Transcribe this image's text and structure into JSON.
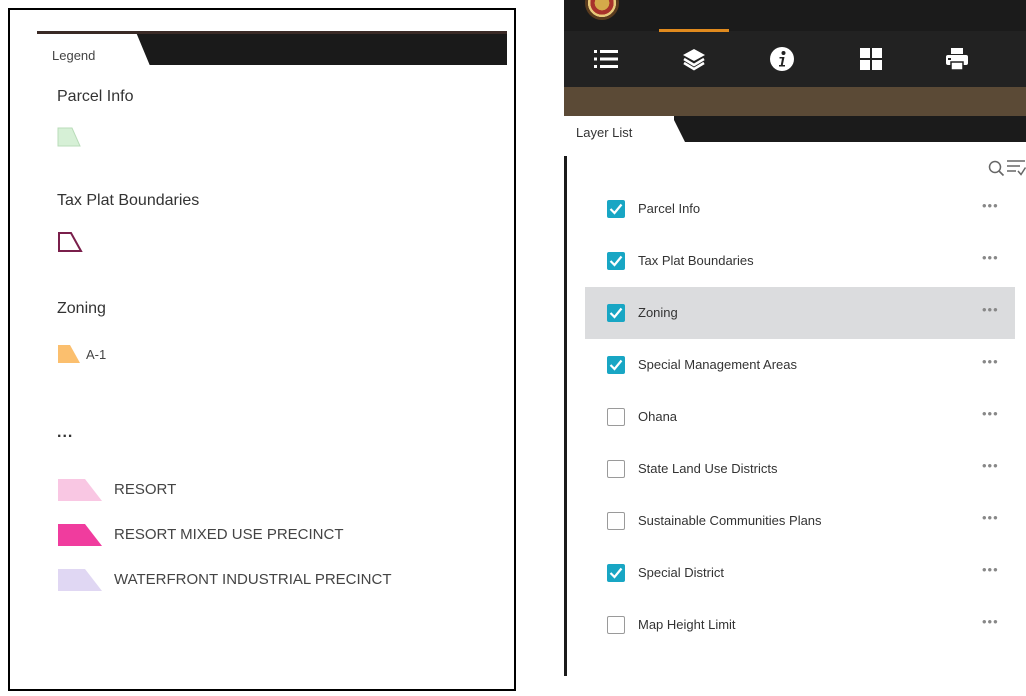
{
  "legend": {
    "tab_label": "Legend",
    "groups": [
      {
        "heading": "Parcel Info"
      },
      {
        "heading": "Tax Plat Boundaries"
      },
      {
        "heading": "Zoning",
        "items": [
          {
            "label": "A-1",
            "color": "#fbbf6e"
          }
        ]
      }
    ],
    "ellipsis": "...",
    "more_items": [
      {
        "label": "RESORT",
        "color": "#f9c7e3"
      },
      {
        "label": "RESORT MIXED USE PRECINCT",
        "color": "#f03c9e"
      },
      {
        "label": "WATERFRONT INDUSTRIAL PRECINCT",
        "color": "#e0d7f3"
      }
    ],
    "parcel_color": "#d6f0d6",
    "tax_plat_color": "#7a1f4b"
  },
  "layer_panel": {
    "toolbar": [
      "legend-icon",
      "layers-icon",
      "info-icon",
      "basemap-gallery-icon",
      "print-icon"
    ],
    "tab_label": "Layer List",
    "menu_glyph": "•••",
    "layers": [
      {
        "name": "Parcel Info",
        "checked": true
      },
      {
        "name": "Tax Plat Boundaries",
        "checked": true
      },
      {
        "name": "Zoning",
        "checked": true,
        "highlighted": true
      },
      {
        "name": "Special Management Areas",
        "checked": true
      },
      {
        "name": "Ohana",
        "checked": false
      },
      {
        "name": "State Land Use Districts",
        "checked": false
      },
      {
        "name": "Sustainable Communities Plans",
        "checked": false
      },
      {
        "name": "Special District",
        "checked": true
      },
      {
        "name": "Map Height Limit",
        "checked": false
      }
    ],
    "colors": {
      "accent": "#18a6c4",
      "toolbar_bg": "#222222",
      "active_tab": "#e08a1e",
      "band": "#5b4a36"
    }
  }
}
